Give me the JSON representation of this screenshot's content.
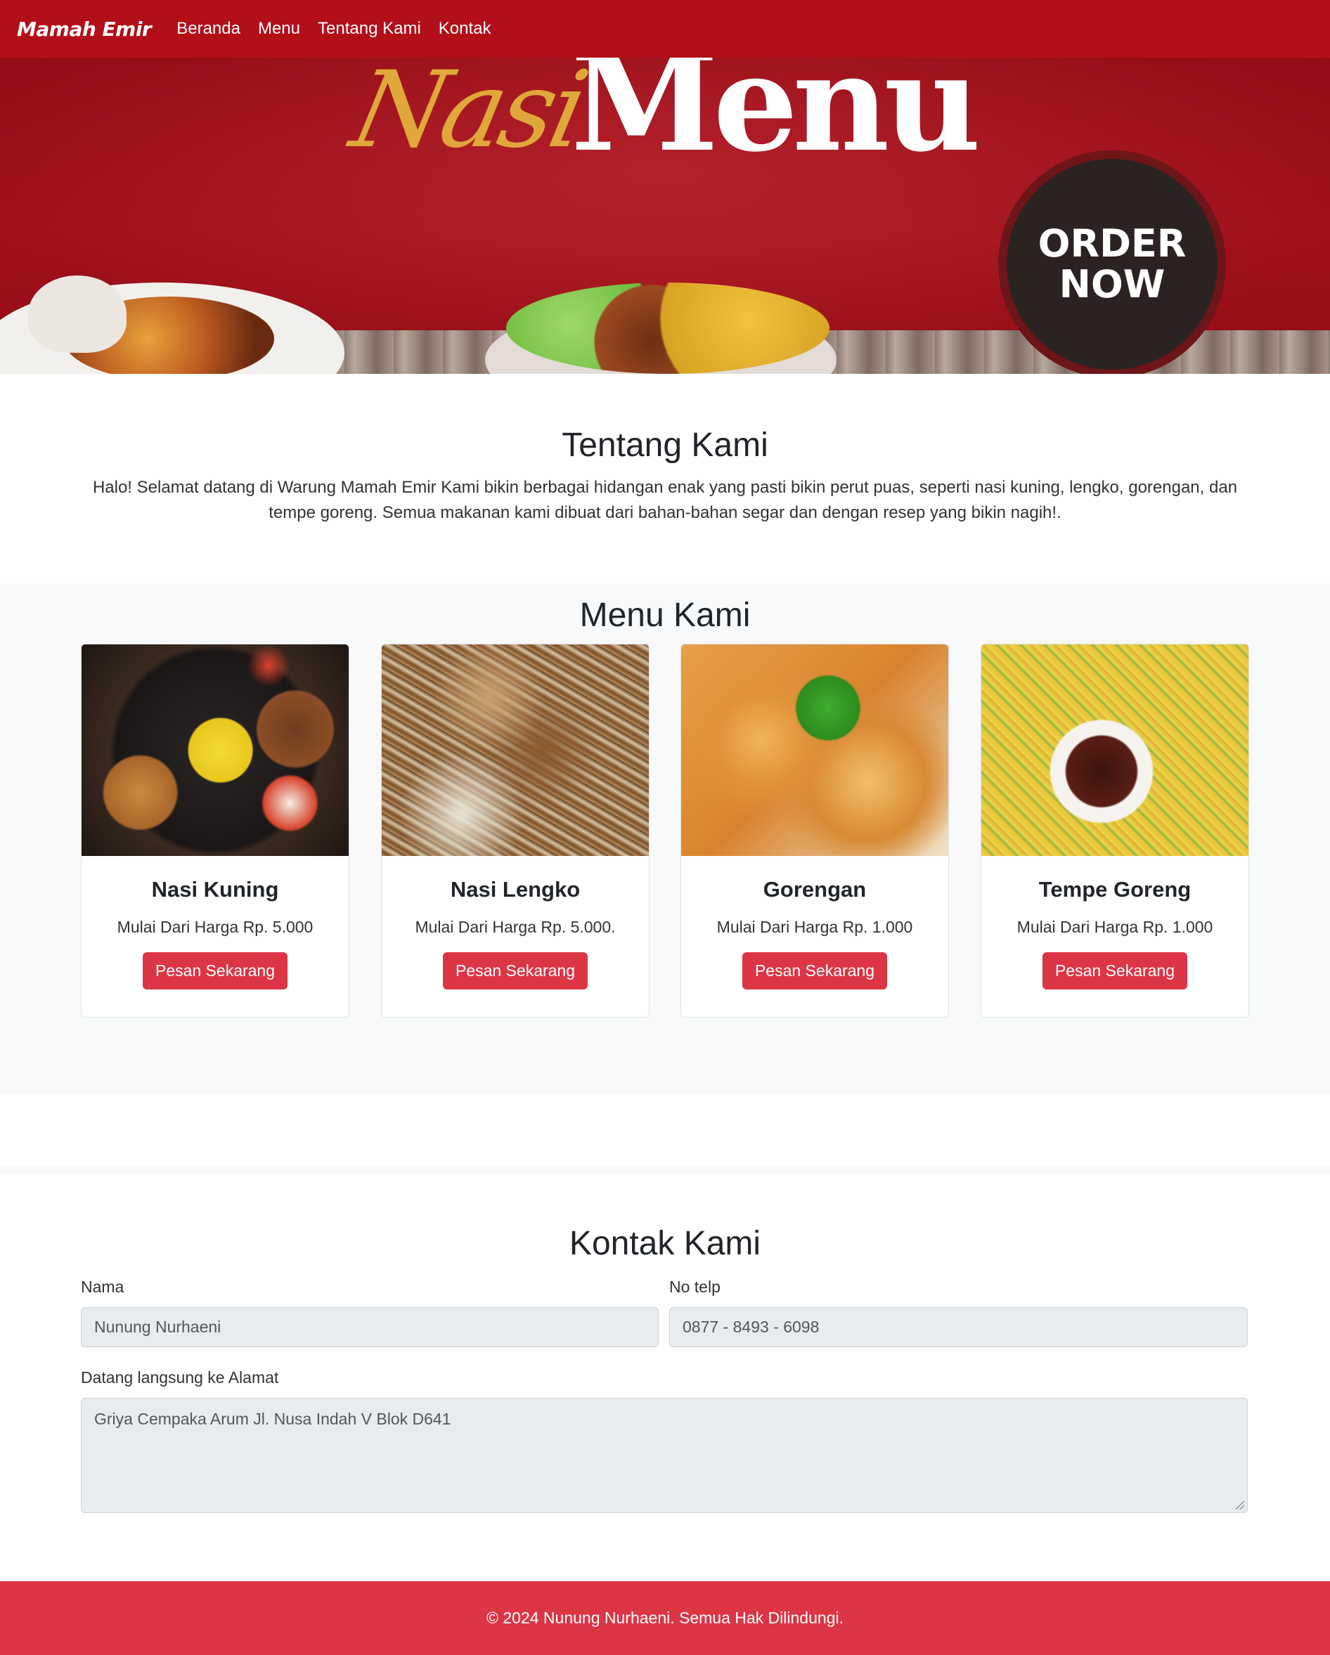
{
  "navbar": {
    "brand": "Mamah Emir",
    "links": [
      "Beranda",
      "Menu",
      "Tentang Kami",
      "Kontak"
    ]
  },
  "hero": {
    "script_text": "Nasi",
    "title": "Menu",
    "order_button": "ORDER NOW"
  },
  "about": {
    "title": "Tentang Kami",
    "text": "Halo! Selamat datang di Warung Mamah Emir Kami bikin berbagai hidangan enak yang pasti bikin perut puas, seperti nasi kuning, lengko, gorengan, dan tempe goreng. Semua makanan kami dibuat dari bahan-bahan segar dan dengan resep yang bikin nagih!."
  },
  "menu": {
    "title": "Menu Kami",
    "items": [
      {
        "name": "Nasi Kuning",
        "price": "Mulai Dari Harga Rp. 5.000",
        "button": "Pesan Sekarang"
      },
      {
        "name": "Nasi Lengko",
        "price": "Mulai Dari Harga Rp. 5.000.",
        "button": "Pesan Sekarang"
      },
      {
        "name": "Gorengan",
        "price": "Mulai Dari Harga Rp. 1.000",
        "button": "Pesan Sekarang"
      },
      {
        "name": "Tempe Goreng",
        "price": "Mulai Dari Harga Rp. 1.000",
        "button": "Pesan Sekarang"
      }
    ]
  },
  "contact": {
    "title": "Kontak Kami",
    "name_label": "Nama",
    "name_value": "Nunung Nurhaeni",
    "phone_label": "No telp",
    "phone_value": "0877 - 8493 - 6098",
    "address_label": "Datang langsung ke Alamat",
    "address_value": "Griya Cempaka Arum Jl. Nusa Indah V Blok D641"
  },
  "footer": {
    "text": "© 2024 Nunung Nurhaeni. Semua Hak Dilindungi."
  },
  "colors": {
    "navbar": "#b20f19",
    "accent": "#dc3545",
    "hero_script": "#e0a83a"
  }
}
